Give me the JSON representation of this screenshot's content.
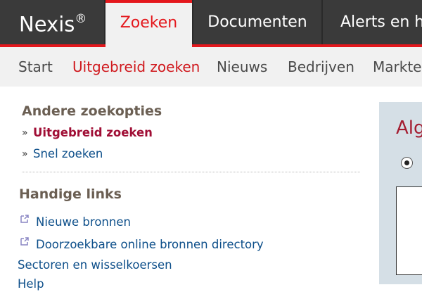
{
  "brand": {
    "name": "Nexis",
    "mark": "®"
  },
  "main_tabs": [
    {
      "label": "Zoeken",
      "active": true
    },
    {
      "label": "Documenten",
      "active": false
    },
    {
      "label": "Alerts en hi",
      "active": false
    }
  ],
  "sub_nav": [
    {
      "label": "Start",
      "active": false
    },
    {
      "label": "Uitgebreid zoeken",
      "active": true
    },
    {
      "label": "Nieuws",
      "active": false
    },
    {
      "label": "Bedrijven",
      "active": false
    },
    {
      "label": "Markte",
      "active": false
    }
  ],
  "search_options": {
    "title": "Andere zoekopties",
    "chevron": "»",
    "items": [
      {
        "label": "Uitgebreid zoeken",
        "active": true
      },
      {
        "label": "Snel zoeken",
        "active": false
      }
    ]
  },
  "handy_links": {
    "title": "Handige links",
    "items": [
      {
        "label": "Nieuwe bronnen",
        "icon": "external-link-icon"
      },
      {
        "label": "Doorzoekbare online bronnen directory",
        "icon": "external-link-icon"
      },
      {
        "label": "Sectoren en wisselkoersen",
        "icon": null
      },
      {
        "label": "Help",
        "icon": null
      }
    ]
  },
  "right_panel": {
    "title": "Alg",
    "radio_selected": true
  },
  "colors": {
    "topbar": "#3a3a3a",
    "accent_red": "#e4171c",
    "subnav_bg": "#f1f1f1",
    "link_blue": "#0d4f8a",
    "active_link": "#a00e35",
    "section_title": "#6b5f53",
    "panel_bg": "#d5dfe6"
  }
}
